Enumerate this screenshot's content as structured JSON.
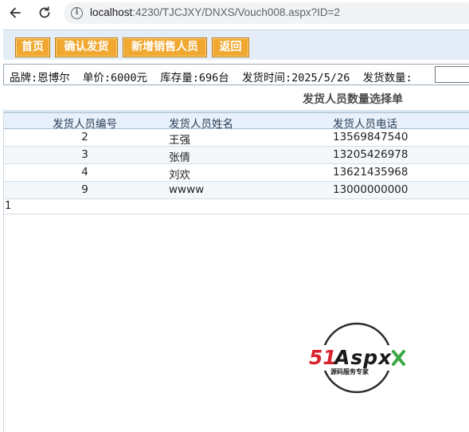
{
  "browser": {
    "url_host": "localhost",
    "url_rest": ":4230/TJCJXY/DNXS/Vouch008.aspx?ID=2"
  },
  "toolbar": {
    "home_label": "首页",
    "confirm_label": "确认发货",
    "add_label": "新增销售人员",
    "back_label": "返回"
  },
  "info": {
    "text": "品牌:恩博尔  单价:6000元  库存量:696台  发货时间:2025/5/26  发货数量:",
    "quantity_value": ""
  },
  "section_title": "发货人员数量选择单",
  "grid": {
    "headers": [
      "发货人员编号",
      "发货人员姓名",
      "发货人员电话"
    ],
    "rows": [
      {
        "id": "2",
        "name": "王强",
        "phone": "13569847540"
      },
      {
        "id": "3",
        "name": "张倩",
        "phone": "13205426978"
      },
      {
        "id": "4",
        "name": "刘欢",
        "phone": "13621435968"
      },
      {
        "id": "9",
        "name": "wwww",
        "phone": "13000000000"
      }
    ]
  },
  "pager": {
    "page": "1"
  },
  "logo": {
    "brand_num": "51",
    "brand_text": "Aspx",
    "tagline": "源码服务专家"
  },
  "colors": {
    "toolbar_bg": "#e4edf7",
    "button_bg": "#f0a830",
    "logo_red": "#d9232e",
    "logo_green": "#3aa845"
  }
}
